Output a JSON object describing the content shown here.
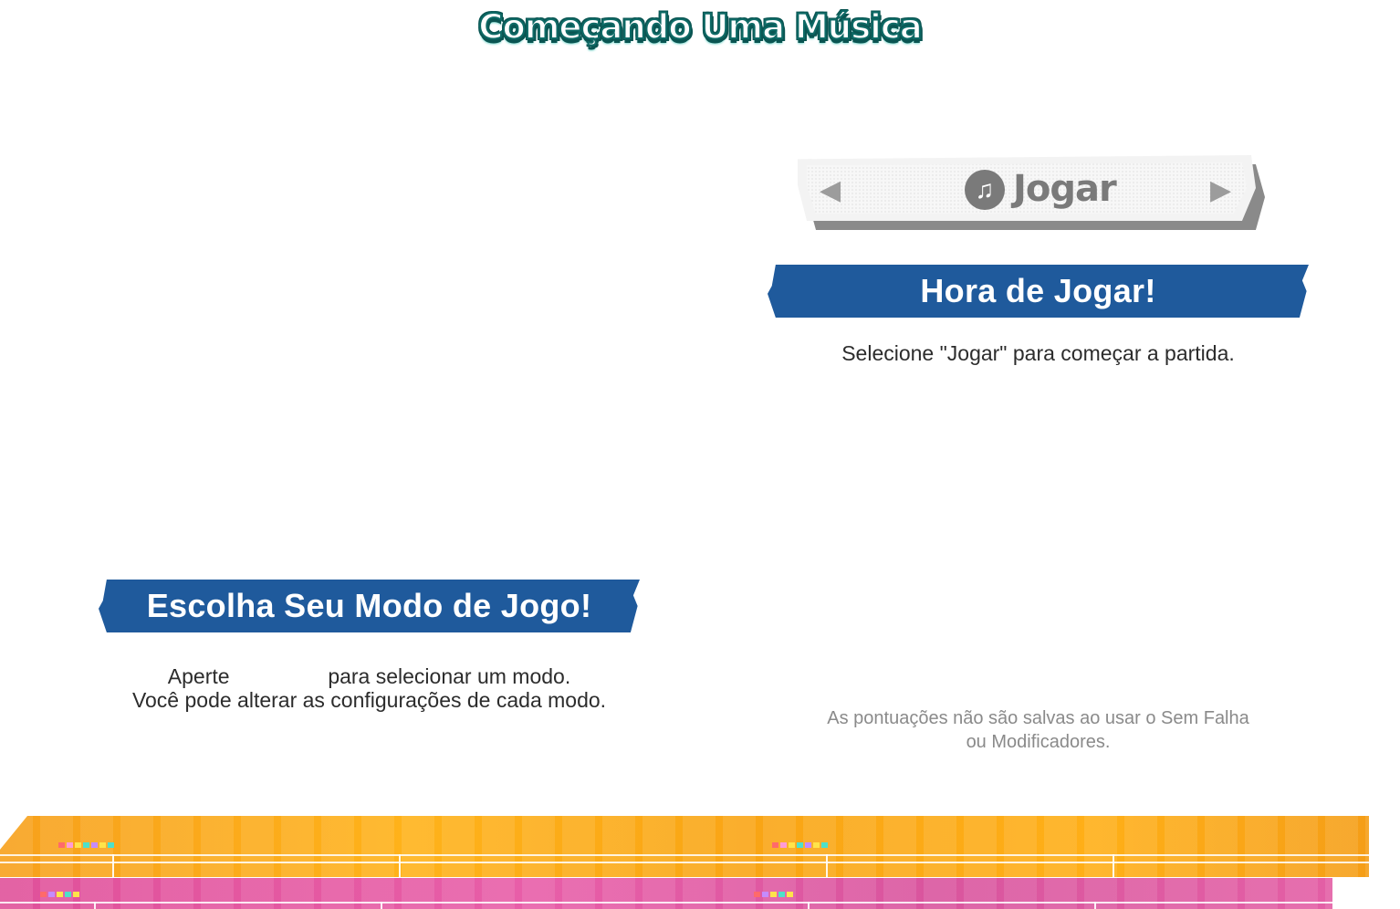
{
  "header": {
    "title": "Começando Uma Música"
  },
  "mode_panel": {
    "banner": "Escolha Seu Modo de Jogo!",
    "line1_before": "Aperte",
    "line1_after": "para selecionar um modo.",
    "line2": "Você pode alterar as configurações de cada modo."
  },
  "play_panel": {
    "selector": {
      "label": "Jogar",
      "left_icon": "left-arrow-icon",
      "right_icon": "right-arrow-icon",
      "note_icon": "music-note-icon"
    },
    "banner": "Hora de Jogar!",
    "description": "Selecione \"Jogar\" para começar a partida.",
    "note": "As pontuações não são salvas ao usar o Sem Falha",
    "note_line2": "ou Modificadores."
  },
  "colors": {
    "banner": "#1f5a9c",
    "title_outline": "#0e6a66",
    "stripe_orange": "#f7a11c",
    "stripe_pink": "#e0519a",
    "note_text": "#8a8a8a"
  }
}
